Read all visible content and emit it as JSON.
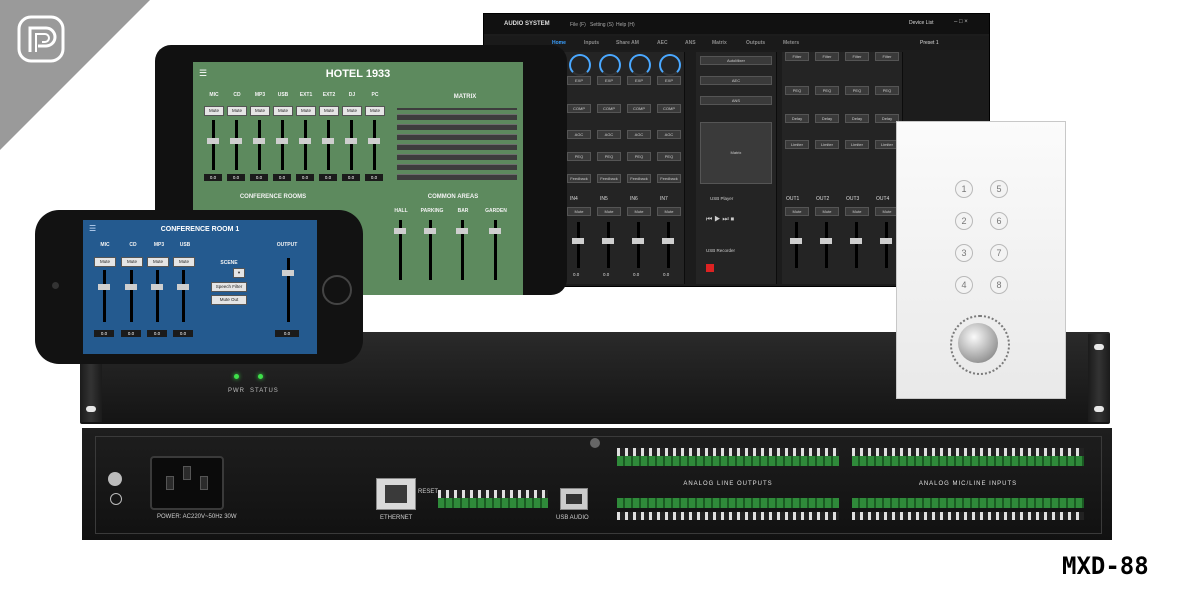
{
  "brand": {
    "logo_icon": "brand-logo-icon",
    "corner_color": "#9a9a9a"
  },
  "pc_app": {
    "title": "AUDIO SYSTEM",
    "menu": [
      "File (F)",
      "Setting (S)",
      "Help (H)"
    ],
    "device_list": "Device List",
    "preset": "Preset 1",
    "tabs": [
      "Home",
      "Inputs",
      "Share AM",
      "AEC",
      "ANS",
      "Matrix",
      "Outputs",
      "Meters"
    ],
    "active_tab": "Home",
    "input_labels": [
      "IN4",
      "IN5",
      "IN6",
      "IN7"
    ],
    "output_labels": [
      "OUT1",
      "OUT2",
      "OUT3",
      "OUT4"
    ],
    "mute_label": "Mute",
    "center_labels": [
      "AutoMixer",
      "AEC",
      "ANS",
      "Matrix",
      "USB Player",
      "USB Recorder"
    ],
    "channel_blocks": [
      "EXP",
      "COMP",
      "AGC",
      "PEQ",
      "Feedback"
    ],
    "output_blocks": [
      "Filter",
      "PEQ",
      "Delay",
      "Limiter"
    ],
    "value": "0.0"
  },
  "tablet": {
    "title": "HOTEL 1933",
    "channels": [
      "MIC",
      "CD",
      "MP3",
      "USB",
      "EXT1",
      "EXT2",
      "DJ",
      "PC"
    ],
    "mute_label": "Mute",
    "value": "0.0",
    "matrix_title": "MATRIX",
    "conference_title": "CONFERENCE ROOMS",
    "common_title": "COMMON AREAS",
    "common_areas": [
      "HALL",
      "PARKING",
      "BAR",
      "GARDEN"
    ]
  },
  "phone": {
    "title": "CONFERENCE ROOM 1",
    "channels": [
      "MIC",
      "CD",
      "MP3",
      "USB"
    ],
    "output_label": "OUTPUT",
    "scene_label": "SCENE",
    "scene_buttons": [
      "Speech Filter",
      "Mute Out"
    ],
    "mute_label": "Mute",
    "value": "0.0"
  },
  "front_panel": {
    "pwr": "PWR",
    "status": "STATUS",
    "led_color": "#3ee04a"
  },
  "rear_panel": {
    "power": "POWER:  AC220V~50Hz 30W",
    "ethernet": "ETHERNET",
    "reset": "RESET",
    "usb_audio": "USB AUDIO",
    "analog_outputs": "ANALOG  LINE  OUTPUTS",
    "analog_inputs": "ANALOG  MIC/LINE  INPUTS"
  },
  "wall_panel": {
    "buttons": [
      "1",
      "5",
      "2",
      "6",
      "3",
      "7",
      "4",
      "8"
    ]
  },
  "model": "MXD-88"
}
